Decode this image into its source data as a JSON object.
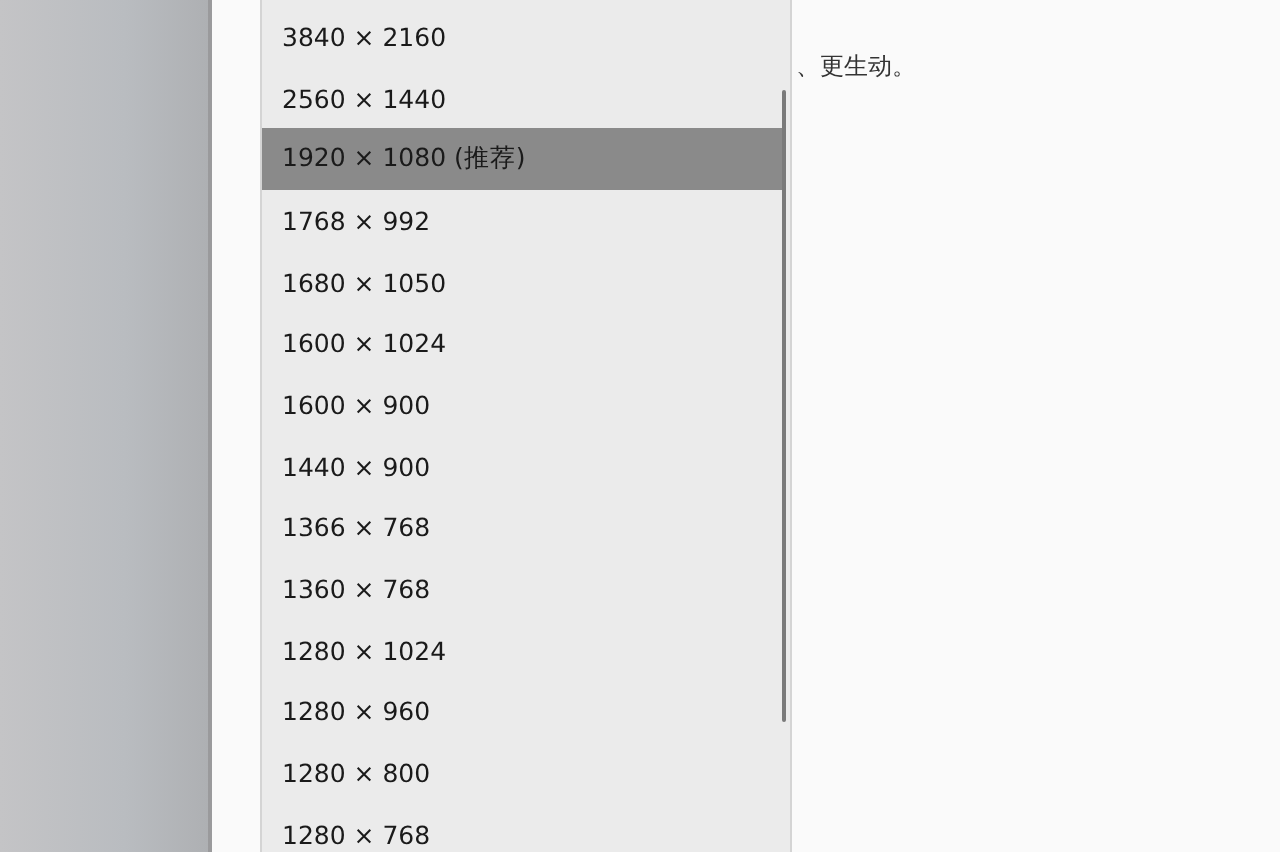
{
  "dropdown": {
    "options": [
      {
        "label": "3840 × 2160",
        "selected": false
      },
      {
        "label": "2560 × 1440",
        "selected": false
      },
      {
        "label": "1920 × 1080 (推荐)",
        "selected": true
      },
      {
        "label": "1768 × 992",
        "selected": false
      },
      {
        "label": "1680 × 1050",
        "selected": false
      },
      {
        "label": "1600 × 1024",
        "selected": false
      },
      {
        "label": "1600 × 900",
        "selected": false
      },
      {
        "label": "1440 × 900",
        "selected": false
      },
      {
        "label": "1366 × 768",
        "selected": false
      },
      {
        "label": "1360 × 768",
        "selected": false
      },
      {
        "label": "1280 × 1024",
        "selected": false
      },
      {
        "label": "1280 × 960",
        "selected": false
      },
      {
        "label": "1280 × 800",
        "selected": false
      },
      {
        "label": "1280 × 768",
        "selected": false
      }
    ]
  },
  "description": "、更生动。"
}
